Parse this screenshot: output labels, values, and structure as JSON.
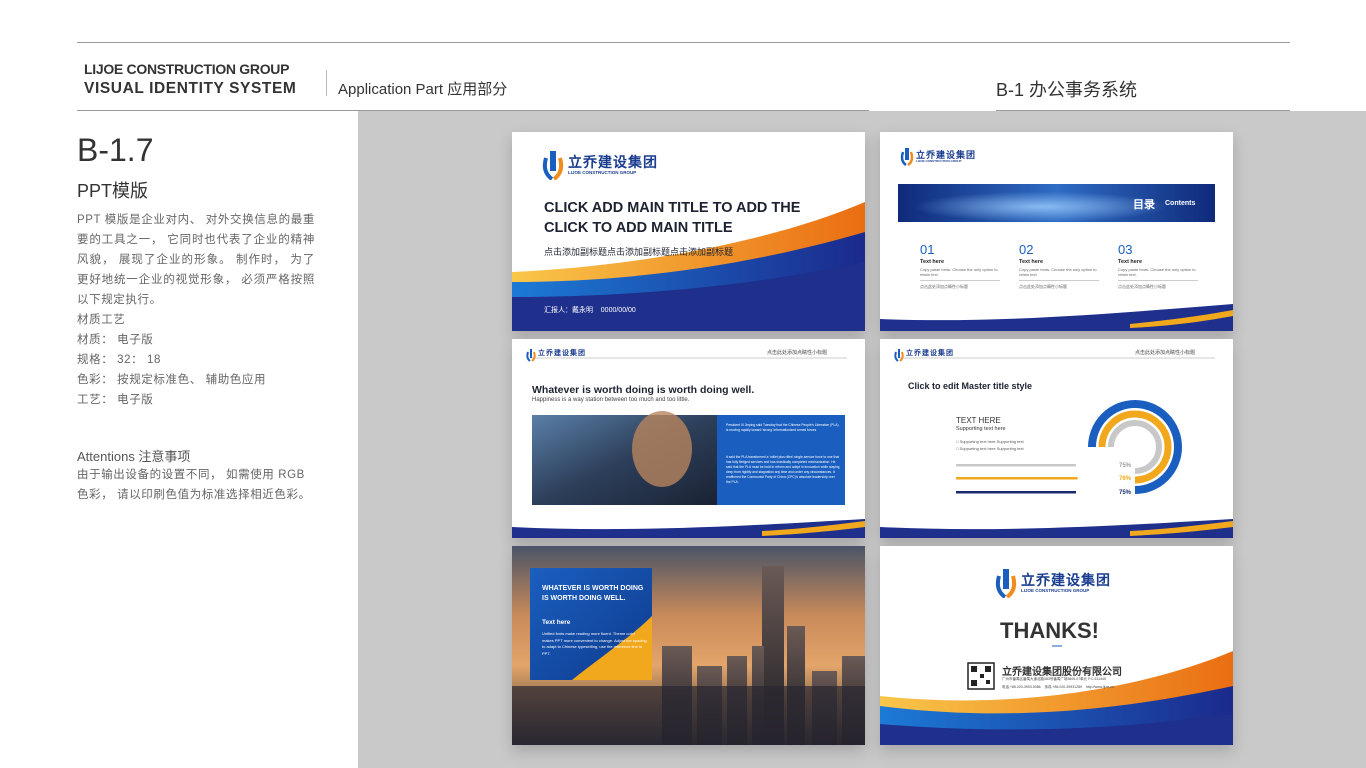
{
  "header": {
    "company_en": "LIJOE CONSTRUCTION GROUP",
    "vis_system": "VISUAL IDENTITY SYSTEM",
    "application_part": "Application Part 应用部分",
    "system_name": "B-1 办公事务系统"
  },
  "section": {
    "number": "B-1.7",
    "title": "PPT模版",
    "description": "PPT 模版是企业对内、 对外交换信息的最重要的工具之一， 它同时也代表了企业的精神风貌， 展现了企业的形象。 制作时， 为了更好地统一企业的视觉形象， 必须严格按照以下规定执行。",
    "specs": [
      "材质工艺",
      "材质： 电子版",
      "规格： 32： 18",
      "色彩： 按规定标准色、 辅助色应用",
      "工艺： 电子版"
    ],
    "attention_title": "Attentions 注意事项",
    "attention_text": "由于输出设备的设置不同， 如需使用 RGB 色彩， 请以印刷色值为标准选择相近色彩。"
  },
  "logo": {
    "cn": "立乔建设集团",
    "en": "LIJOE CONSTRUCTION GROUP"
  },
  "slide_cover": {
    "title_line1": "CLICK ADD MAIN TITLE TO ADD THE",
    "title_line2": "CLICK TO ADD MAIN TITLE",
    "subtitle": "点击添加副标题点击添加副标题点击添加副标题",
    "reporter": "汇报人：戴永明    0000/00/00"
  },
  "slide_contents": {
    "label_cn": "目录",
    "label_en": "Contents",
    "items": [
      {
        "num": "01",
        "head": "Text here",
        "text": "Copy paste fonts. Choose the only option to retain text.",
        "cn": "点击此处添加点睛性小标题"
      },
      {
        "num": "02",
        "head": "Text here",
        "text": "Copy paste fonts. Choose the only option to retain text.",
        "cn": "点击此处添加点睛性小标题"
      },
      {
        "num": "03",
        "head": "Text here",
        "text": "Copy paste fonts. Choose the only option to retain text.",
        "cn": "点击此处添加点睛性小标题"
      }
    ]
  },
  "slide_content1": {
    "header_right": "点击此处添加点睛性小标题",
    "title": "Whatever is worth doing is worth doing well.",
    "subtitle": "Happiness is a way station between too much and too little.",
    "para1": "President Xi Jinping said Tuesday that the Chinese People's Liberation (PLA) is moving rapidly toward 'strong' informationized armed forces.",
    "para2": "It said the PLA transformed a 'millet plus rifles' single-service force to one that has fully fledged services and has drastically completed mechanization. He said that the PLA must be bold in reform and adept in innovation while staying deep from rigidity and stagnation any time and under any circumstances. It reaffirmed the Communist Party of China (CPC)'s absolute leadership over the PLA."
  },
  "slide_content2": {
    "header_right": "点击此处添加点睛性小标题",
    "title": "Click to edit Master title style",
    "text_here": "TEXT HERE",
    "supporting": "Supporting text here",
    "bullets": [
      "Supporting text here Supporting text",
      "Supporting text here Supporting text"
    ],
    "bars": [
      {
        "label": "75%",
        "value": 75,
        "color": "#c8c8c8"
      },
      {
        "label": "76%",
        "value": 76,
        "color": "#f2a81d"
      },
      {
        "label": "75%",
        "value": 75,
        "color": "#1b2a6b"
      }
    ]
  },
  "slide_city": {
    "title": "WHATEVER IS WORTH DOING IS WORTH DOING WELL.",
    "text_here": "Text here",
    "body": "Unified fonts make reading more fluent. Theme color makes PPT more convenient to change. Adjust the spacing to adapt to Chinese typesetting, use the reference line in PPT."
  },
  "slide_thanks": {
    "thanks": "THANKS!",
    "company": "立乔建设集团股份有限公司",
    "address": "广州市番禺区番禺大道北路383号番禺广场3605-07单元 P.C.511445",
    "contact": "电话:+86.020-3993-5086    传真:+86.020-39931289    http://www.lijoe.cn"
  },
  "colors": {
    "navy": "#1b2a6b",
    "blue": "#1a5fc0",
    "orange": "#f2a81d",
    "gray_bg": "#c9c9c9"
  }
}
